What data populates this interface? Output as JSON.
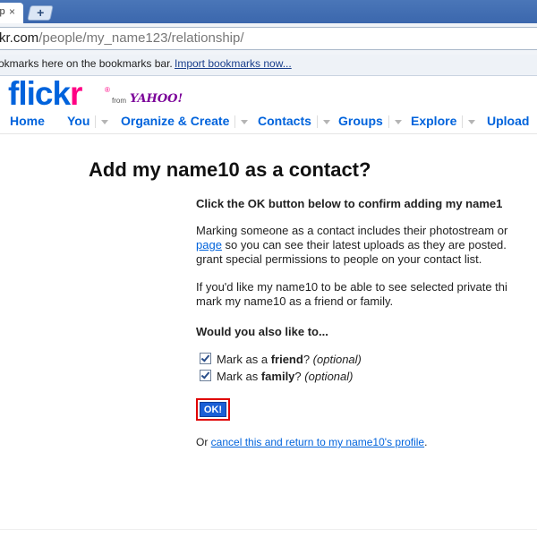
{
  "browser": {
    "tab_title": "ip",
    "tab_close": "×",
    "new_tab": "+",
    "url_host": "kr.com",
    "url_path": "/people/my_name123/relationship/",
    "bookmarks_hint": "okmarks here on the bookmarks bar.",
    "import_bookmarks": "Import bookmarks now..."
  },
  "logo": {
    "flick": "flick",
    "r": "r",
    "reg": "®",
    "from": "from",
    "yahoo": "YAHOO!"
  },
  "nav": {
    "items": [
      {
        "label": "Home"
      },
      {
        "label": "You"
      },
      {
        "label": "Organize & Create"
      },
      {
        "label": "Contacts"
      },
      {
        "label": "Groups"
      },
      {
        "label": "Explore"
      },
      {
        "label": "Upload"
      }
    ]
  },
  "main": {
    "title": "Add my name10 as a contact?",
    "confirm": "Click the OK button below to confirm adding my name1",
    "p1_line1": "Marking someone as a contact includes their photostream or",
    "p1_link": "page",
    "p1_line2_rest": " so you can see their latest uploads as they are posted.",
    "p1_line3": "grant special permissions to people on your contact list.",
    "p2_line1": "If you'd like my name10 to be able to see selected private thi",
    "p2_line2": "mark my name10 as a friend or family.",
    "also": "Would you also like to...",
    "friend_pre": "Mark as a ",
    "friend_bold": "friend",
    "friend_q": "?",
    "family_pre": "Mark as ",
    "family_bold": "family",
    "family_q": "?",
    "optional": "(optional)",
    "ok": "OK!",
    "cancel_pre": "Or ",
    "cancel_link": "cancel this and return to my name10's profile",
    "cancel_post": "."
  },
  "checkboxes": {
    "friend_checked": true,
    "family_checked": true
  }
}
